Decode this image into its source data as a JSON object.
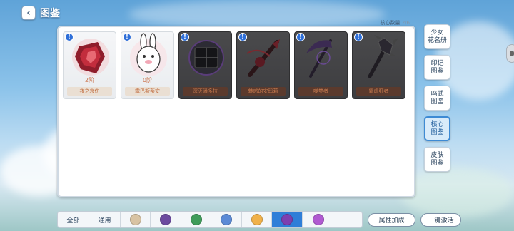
{
  "header": {
    "back_icon": "chevron-left-icon",
    "title": "图鉴"
  },
  "counter": {
    "label": "核心数量",
    "value": "2/6"
  },
  "cards": [
    {
      "name": "夜之哀伤",
      "level": "2阶",
      "locked": false,
      "icon": "crimson-crystal-icon"
    },
    {
      "name": "露巴斯蒂安",
      "level": "0阶",
      "locked": false,
      "icon": "bunny-plush-icon"
    },
    {
      "name": "深灭潘多拉",
      "level": "",
      "locked": true,
      "icon": "dark-box-icon"
    },
    {
      "name": "魅惑的安玛莉",
      "level": "",
      "locked": true,
      "icon": "rose-blade-icon"
    },
    {
      "name": "噬梦者",
      "level": "",
      "locked": true,
      "icon": "scythe-icon"
    },
    {
      "name": "霸虐狂者",
      "level": "",
      "locked": true,
      "icon": "spiked-club-icon"
    }
  ],
  "side_tabs": [
    {
      "label": "少女\n花名册",
      "active": false
    },
    {
      "label": "印记\n图鉴",
      "active": false
    },
    {
      "label": "鸣武\n图鉴",
      "active": false
    },
    {
      "label": "核心\n图鉴",
      "active": true
    },
    {
      "label": "皮肤\n图鉴",
      "active": false
    }
  ],
  "filters": [
    {
      "label": "全部",
      "active": false,
      "icon": ""
    },
    {
      "label": "通用",
      "active": false,
      "icon": ""
    },
    {
      "label": "",
      "active": false,
      "icon": "moon-sigil-icon",
      "color": "#d8c3a3"
    },
    {
      "label": "",
      "active": false,
      "icon": "violet-star-icon",
      "color": "#6c4a9f"
    },
    {
      "label": "",
      "active": false,
      "icon": "leaf-swirl-icon",
      "color": "#3f9c5a"
    },
    {
      "label": "",
      "active": false,
      "icon": "shield-gem-icon",
      "color": "#5b8ad6"
    },
    {
      "label": "",
      "active": false,
      "icon": "sun-burst-icon",
      "color": "#f0b14a"
    },
    {
      "label": "",
      "active": true,
      "icon": "purple-crest-icon",
      "color": "#7d3fb0"
    },
    {
      "label": "",
      "active": false,
      "icon": "magenta-orb-icon",
      "color": "#b05ad1"
    }
  ],
  "buttons": {
    "attribute_bonus": "属性加成",
    "one_click_activate": "一键激活"
  },
  "colors": {
    "accent_blue": "#2f7ed8",
    "card_label_text": "#c06b3d"
  }
}
